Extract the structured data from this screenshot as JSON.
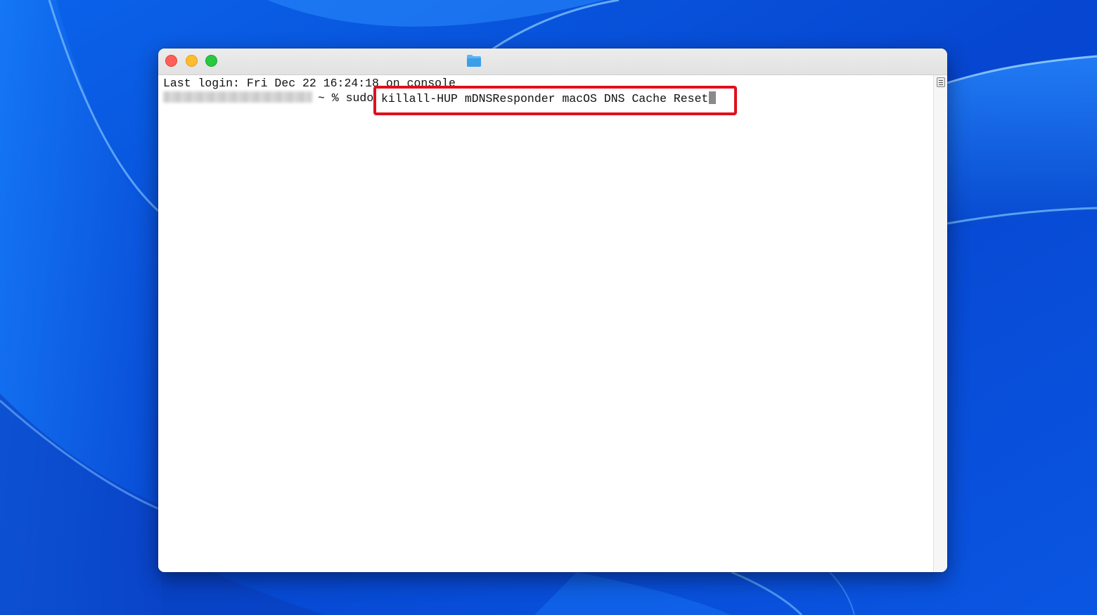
{
  "window": {
    "folder_icon": "folder-icon",
    "controls": [
      "close",
      "minimize",
      "zoom"
    ]
  },
  "terminal": {
    "last_login": "Last login: Fri Dec 22 16:24:18 on console",
    "prompt_suffix": "~ %",
    "command_prefix": "sudo",
    "highlighted_command": "killall-HUP mDNSResponder macOS DNS Cache Reset"
  },
  "colors": {
    "highlight_border": "#e0101c",
    "wallpaper": "#0a4fd8"
  }
}
